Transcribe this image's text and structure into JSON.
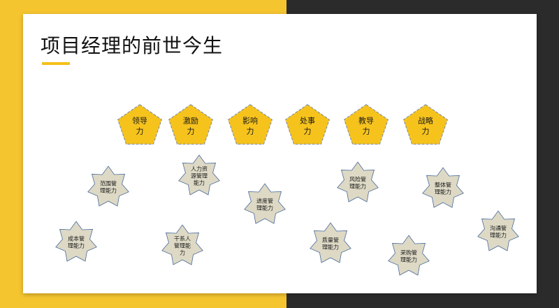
{
  "slide": {
    "title": "项目经理的前世今生",
    "colors": {
      "left_band": "#f5c530",
      "right_band": "#2b2b2b",
      "accent_underline": "#f5c01a",
      "pentagon_fill": "#f6c31d",
      "pentagon_stroke": "#7a8aa0",
      "star_fill": "#ddd9c5",
      "star_stroke": "#4a6a9a"
    }
  },
  "powers": [
    {
      "lines": [
        "领导",
        "力"
      ]
    },
    {
      "lines": [
        "激励",
        "力"
      ]
    },
    {
      "lines": [
        "影响",
        "力"
      ]
    },
    {
      "lines": [
        "处事",
        "力"
      ]
    },
    {
      "lines": [
        "教导",
        "力"
      ]
    },
    {
      "lines": [
        "战略",
        "力"
      ]
    }
  ],
  "skills": [
    {
      "lines": [
        "范围管",
        "理能力"
      ]
    },
    {
      "lines": [
        "人力资",
        "源管理",
        "能力"
      ]
    },
    {
      "lines": [
        "进度管",
        "理能力"
      ]
    },
    {
      "lines": [
        "风险管",
        "理能力"
      ]
    },
    {
      "lines": [
        "整体管",
        "理能力"
      ]
    },
    {
      "lines": [
        "成本管",
        "理能力"
      ]
    },
    {
      "lines": [
        "干系人",
        "管理能",
        "力"
      ]
    },
    {
      "lines": [
        "质量管",
        "理能力"
      ]
    },
    {
      "lines": [
        "采购管",
        "理能力"
      ]
    },
    {
      "lines": [
        "沟通管",
        "理能力"
      ]
    }
  ]
}
